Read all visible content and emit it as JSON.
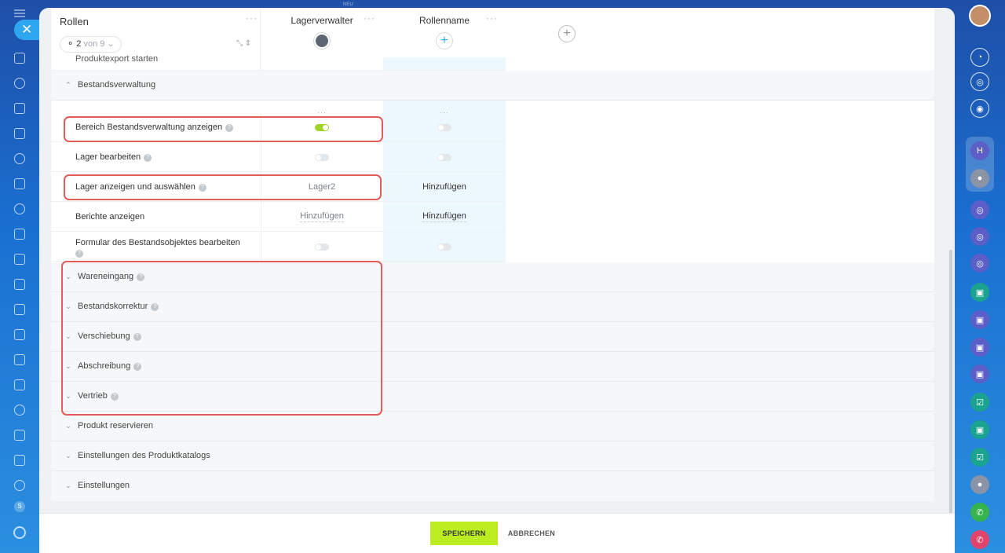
{
  "header": {
    "neu_label": "NEU",
    "rollen_title": "Rollen",
    "pager_count": "2",
    "pager_of": "von 9",
    "roles": [
      {
        "name": "Lagerverwalter"
      },
      {
        "name": "Rollenname"
      }
    ]
  },
  "cut_row_label": "Produktexport starten",
  "sections": {
    "bestandsverwaltung": {
      "title": "Bestandsverwaltung",
      "rows": [
        {
          "label": "Bereich Bestandsverwaltung anzeigen",
          "role1_toggle": true,
          "role2_toggle": false
        },
        {
          "label": "Lager bearbeiten",
          "role1_toggle": false,
          "role2_toggle": false
        },
        {
          "label": "Lager anzeigen und auswählen",
          "role1_value": "Lager2",
          "role2_value": "Hinzufügen"
        },
        {
          "label": "Berichte anzeigen",
          "role1_value": "Hinzufügen",
          "role2_value": "Hinzufügen"
        },
        {
          "label": "Formular des Bestandsobjektes bearbeiten",
          "role1_toggle": false,
          "role2_toggle": false
        }
      ]
    },
    "collapsed": [
      {
        "title": "Wareneingang"
      },
      {
        "title": "Bestandskorrektur"
      },
      {
        "title": "Verschiebung"
      },
      {
        "title": "Abschreibung"
      },
      {
        "title": "Vertrieb"
      },
      {
        "title": "Produkt reservieren"
      },
      {
        "title": "Einstellungen des Produktkatalogs"
      },
      {
        "title": "Einstellungen"
      }
    ]
  },
  "footer": {
    "save_label": "SPEICHERN",
    "cancel_label": "ABBRECHEN"
  },
  "colors": {
    "accent_green": "#bbed21",
    "toggle_on": "#9dd629",
    "highlight_box": "#e25c5c",
    "column_highlight": "#ecf8fe"
  },
  "left_sidebar_badge": "S"
}
